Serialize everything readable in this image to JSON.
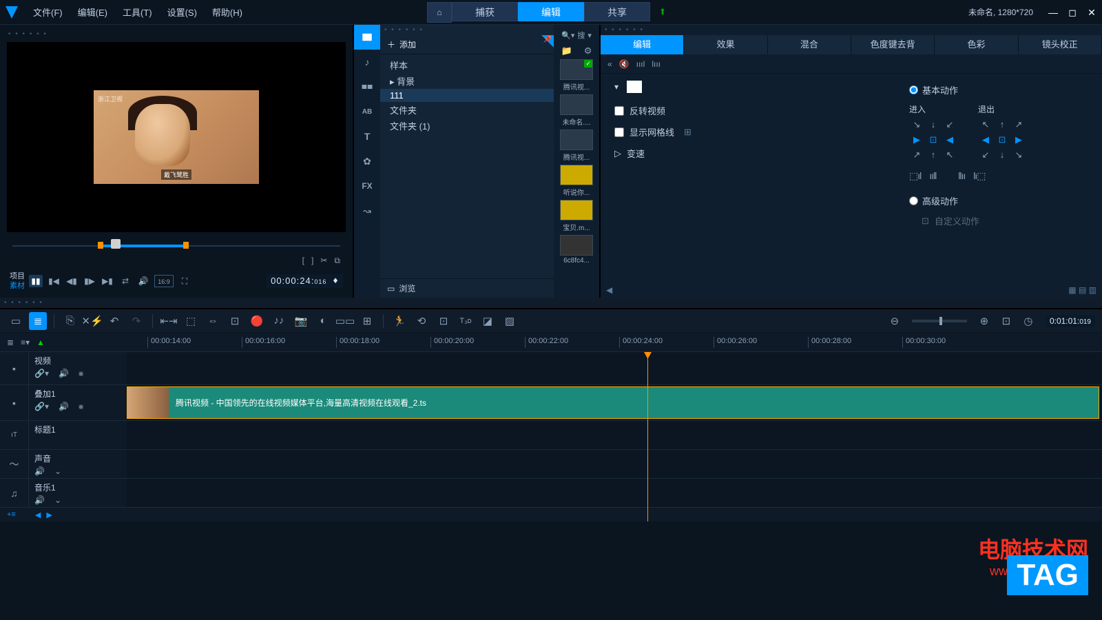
{
  "menu": {
    "file": "文件(F)",
    "edit": "编辑(E)",
    "tools": "工具(T)",
    "settings": "设置(S)",
    "help": "帮助(H)"
  },
  "toptabs": {
    "home": "⌂",
    "capture": "捕获",
    "edit": "编辑",
    "share": "共享"
  },
  "project_info": "未命名, 1280*720",
  "preview": {
    "project_label": "项目",
    "material_label": "素材",
    "timecode": "00:00:24:",
    "timecode_frames": "016",
    "aspect": "16:9",
    "watermark": "浙江卫视",
    "caption": "戴飞鹭胜"
  },
  "library": {
    "add": "添加",
    "browse": "浏览",
    "search_placeholder": "搜",
    "folders": [
      "样本",
      "背景",
      "111",
      "文件夹",
      "文件夹 (1)"
    ],
    "thumbs": [
      "腾讯视...",
      "未命名....",
      "腾讯视...",
      "听说你...",
      "宝贝.m...",
      "6c8fc4..."
    ]
  },
  "sidetools": [
    "media",
    "audio",
    "transition",
    "title",
    "text",
    "overlay",
    "fx",
    "motion"
  ],
  "proptabs": [
    "编辑",
    "效果",
    "混合",
    "色度键去背",
    "色彩",
    "镜头校正"
  ],
  "props": {
    "reverse": "反转视频",
    "grid": "显示网格线",
    "speed": "变速",
    "basic": "基本动作",
    "enter": "进入",
    "exit": "退出",
    "advanced": "高级动作",
    "custom": "自定义动作"
  },
  "ruler": [
    "00:00:14:00",
    "00:00:16:00",
    "00:00:18:00",
    "00:00:20:00",
    "00:00:22:00",
    "00:00:24:00",
    "00:00:26:00",
    "00:00:28:00",
    "00:00:30:00"
  ],
  "tracks": [
    {
      "icon": "■",
      "name": "视频",
      "ctrls": [
        "🔗",
        "🔊",
        "⨳"
      ]
    },
    {
      "icon": "■",
      "name": "叠加1",
      "ctrls": [
        "🔗",
        "🔊",
        "⨳"
      ]
    },
    {
      "icon": "T",
      "name": "标题1",
      "ctrls": []
    },
    {
      "icon": "〜",
      "name": "声音",
      "ctrls": [
        "🔊",
        "⌄"
      ]
    },
    {
      "icon": "♫",
      "name": "音乐1",
      "ctrls": [
        "🔊",
        "⌄"
      ]
    }
  ],
  "clip_name": "腾讯视频 - 中国领先的在线视频媒体平台,海量高清视频在线观看_2.ts",
  "end_timecode": "0:01:01:",
  "end_tc_frames": "019",
  "watermark": {
    "l1": "电脑技术网",
    "l2": "www.tagxp.com",
    "tag": "TAG"
  }
}
